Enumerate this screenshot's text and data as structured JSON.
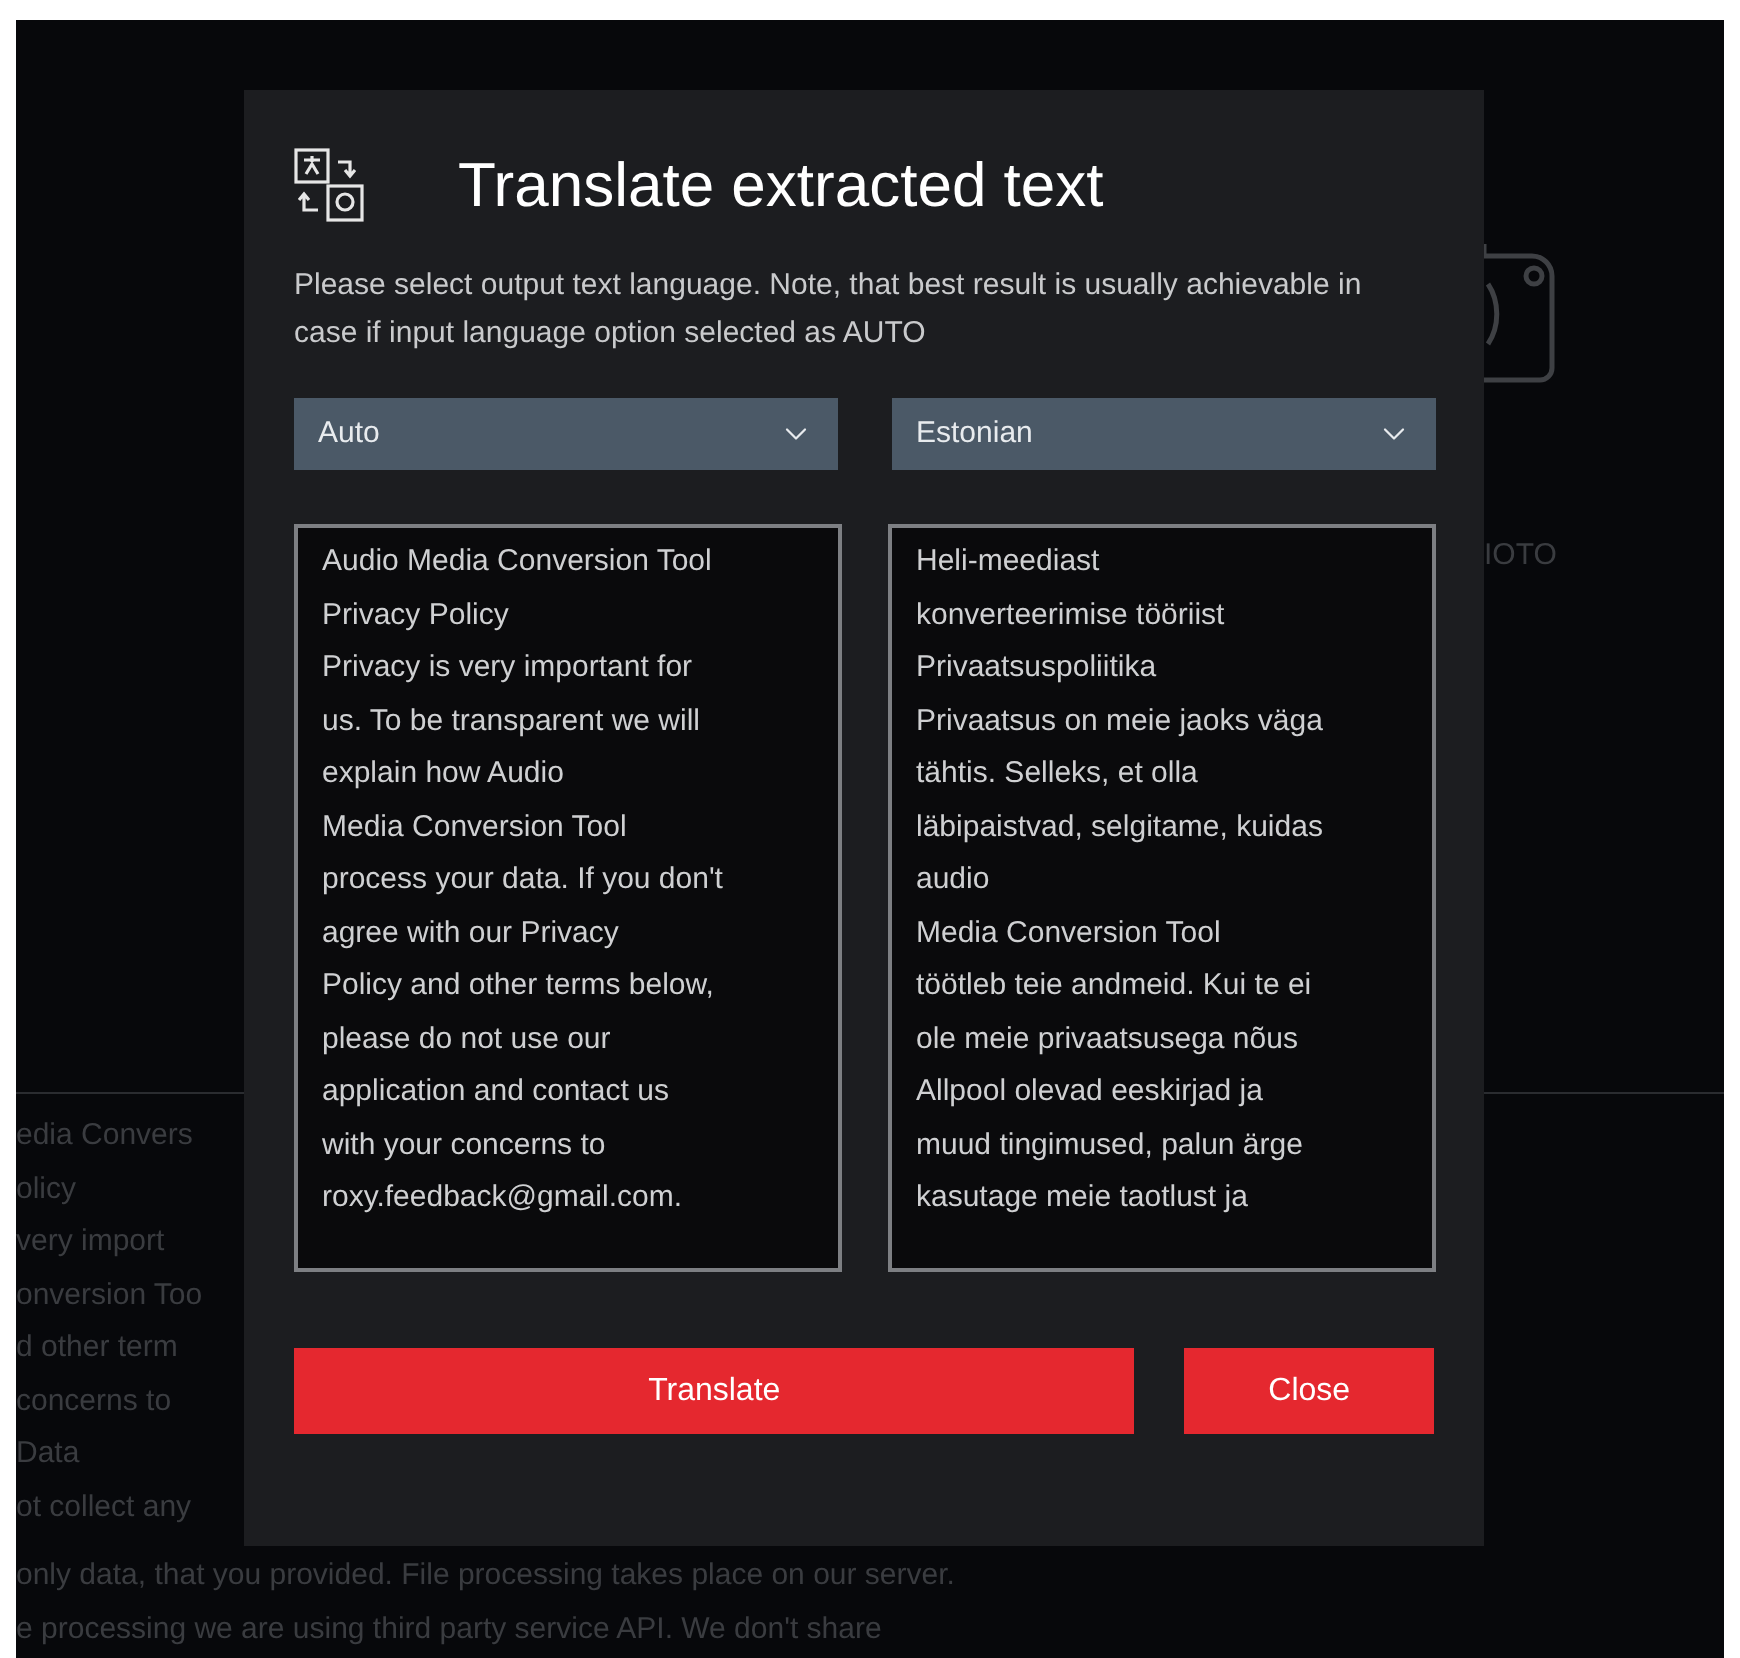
{
  "background": {
    "left_lines": [
      "edia Convers",
      "olicy",
      "very import",
      "onversion Too",
      "d other term",
      "concerns to",
      "Data",
      "ot collect any"
    ],
    "photo_label": "IOTO",
    "bottom_lines": [
      "only data, that you provided. File processing takes place on our server.",
      "e processing we are using third party service API. We don't share"
    ]
  },
  "dialog": {
    "title": "Translate extracted text",
    "description": "Please select output text language. Note, that best result is usually achievable in case if input language option selected as AUTO",
    "source_language": "Auto",
    "target_language": "Estonian",
    "source_text": [
      "Audio Media Conversion Tool",
      "Privacy Policy",
      "Privacy is very important for",
      "us. To be transparent we will",
      "explain how Audio",
      "Media Conversion Tool",
      "process your data. If you don't",
      "agree with our Privacy",
      "Policy and other terms below,",
      "please do not use our",
      "application and contact us",
      "with your concerns to",
      "roxy.feedback@gmail.com."
    ],
    "target_text": [
      "Heli-meediast",
      "konverteerimise tööriist",
      "Privaatsuspoliitika",
      "Privaatsus on meie jaoks väga",
      "tähtis. Selleks, et olla",
      "läbipaistvad, selgitame, kuidas",
      "audio",
      "Media Conversion Tool",
      "töötleb teie andmeid. Kui te ei",
      "ole meie privaatsusega nõus",
      "Allpool olevad eeskirjad ja",
      "muud tingimused, palun ärge",
      "kasutage meie taotlust ja"
    ],
    "buttons": [
      "Translate",
      "Close"
    ]
  }
}
